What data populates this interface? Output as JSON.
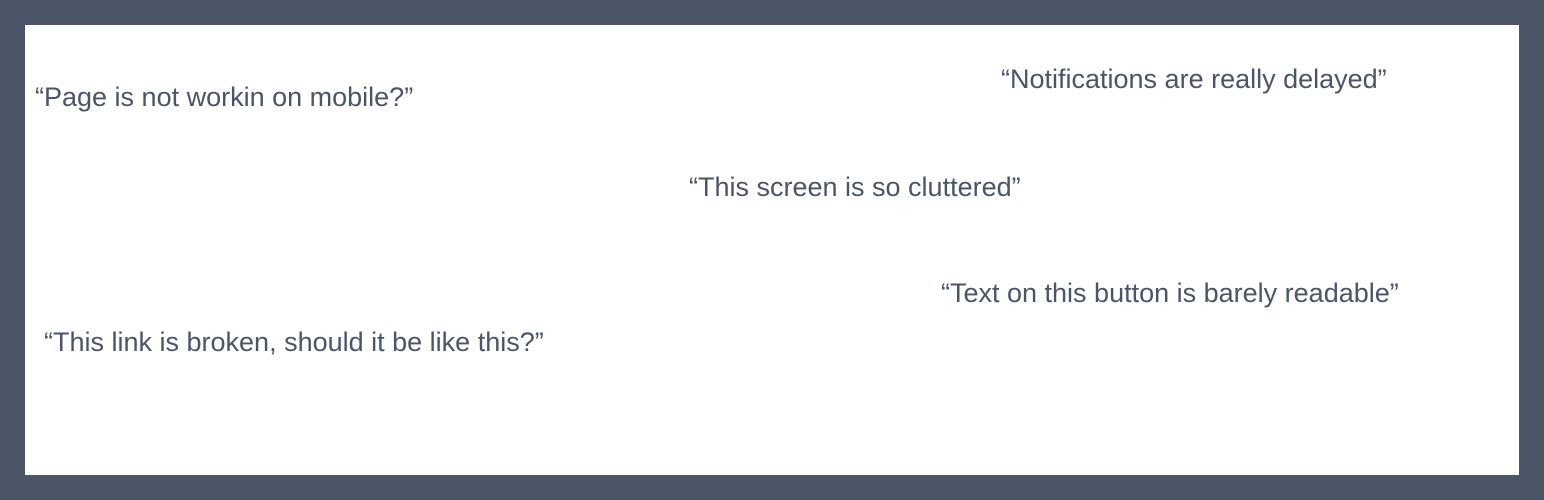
{
  "colors": {
    "page_background": "#4a5568",
    "card_background": "#ffffff",
    "text": "#4a5568"
  },
  "quotes": [
    "“Page is not workin on mobile?”",
    "“Notifications are really delayed”",
    "“This screen is so cluttered”",
    "“Text on this button is barely readable”",
    "“This link is broken, should it be like this?”"
  ]
}
